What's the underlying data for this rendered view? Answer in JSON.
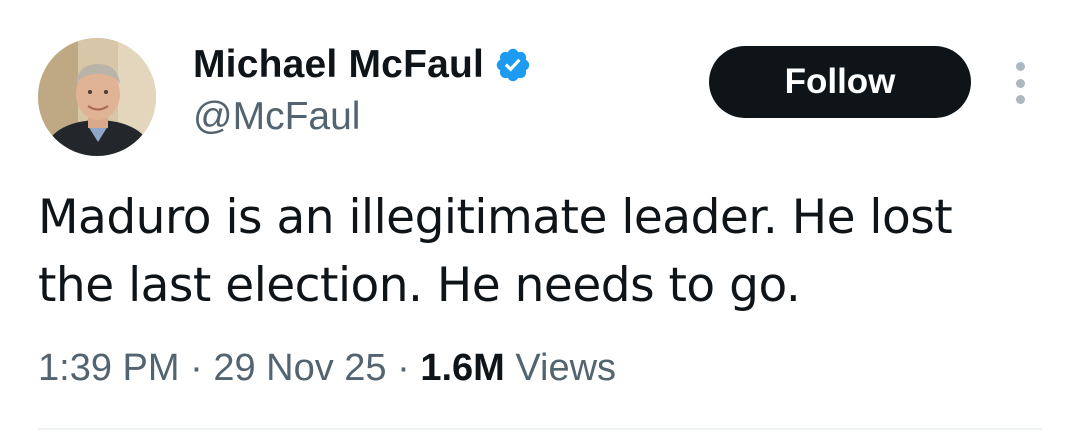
{
  "author": {
    "display_name": "Michael McFaul",
    "handle": "@McFaul",
    "verified": true,
    "verified_color": "#1d9bf0"
  },
  "actions": {
    "follow_label": "Follow",
    "more_icon": "more-vertical-icon"
  },
  "tweet": {
    "text_lines": [
      "Maduro is an illegitimate leader. He lost",
      "the last election. He needs to go."
    ]
  },
  "meta": {
    "time": "1:39 PM",
    "separator": "·",
    "date": "29 Nov 25",
    "views_count": "1.6M",
    "views_label": "Views"
  },
  "colors": {
    "text_primary": "#0f1419",
    "text_secondary": "#536471",
    "button_bg": "#0f1419"
  }
}
